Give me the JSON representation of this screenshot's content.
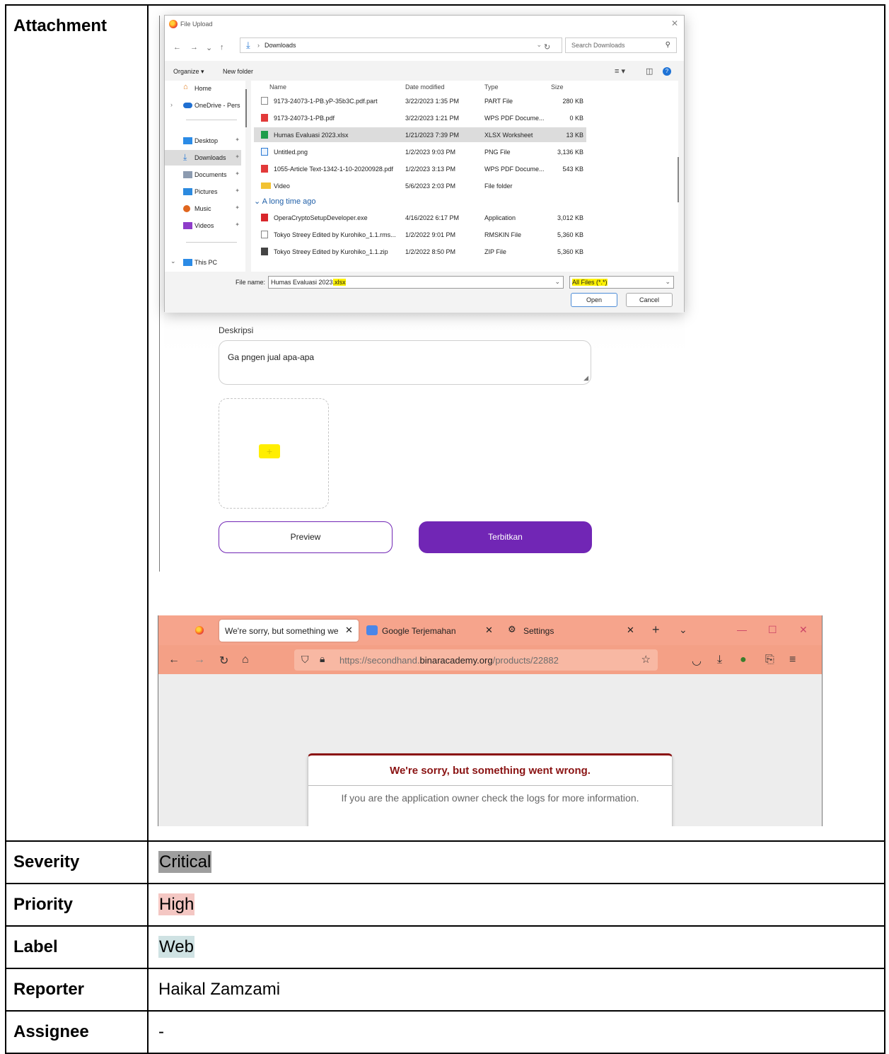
{
  "rows": {
    "attachment": {
      "label": "Attachment"
    },
    "severity": {
      "label": "Severity",
      "value": "Critical",
      "color": "#9e9e9e"
    },
    "priority": {
      "label": "Priority",
      "value": "High",
      "color": "#f4c7c3"
    },
    "label": {
      "label": "Label",
      "value": "Web",
      "color": "#cfe2e3"
    },
    "reporter": {
      "label": "Reporter",
      "value": "Haikal Zamzami"
    },
    "assignee": {
      "label": "Assignee",
      "value": "-"
    }
  },
  "dialog": {
    "title": "File Upload",
    "path": "Downloads",
    "search_placeholder": "Search Downloads",
    "organize": "Organize ▾",
    "new_folder": "New folder",
    "nav": [
      "Home",
      "OneDrive - Pers",
      "Desktop",
      "Downloads",
      "Documents",
      "Pictures",
      "Music",
      "Videos",
      "This PC"
    ],
    "columns": [
      "Name",
      "Date modified",
      "Type",
      "Size"
    ],
    "files": [
      {
        "name": "9173-24073-1-PB.yP-35b3C.pdf.part",
        "date": "3/22/2023 1:35 PM",
        "type": "PART File",
        "size": "280 KB"
      },
      {
        "name": "9173-24073-1-PB.pdf",
        "date": "3/22/2023 1:21 PM",
        "type": "WPS PDF Docume...",
        "size": "0 KB"
      },
      {
        "name": "Humas Evaluasi 2023.xlsx",
        "date": "1/21/2023 7:39 PM",
        "type": "XLSX Worksheet",
        "size": "13 KB"
      },
      {
        "name": "Untitled.png",
        "date": "1/2/2023 9:03 PM",
        "type": "PNG File",
        "size": "3,136 KB"
      },
      {
        "name": "1055-Article Text-1342-1-10-20200928.pdf",
        "date": "1/2/2023 3:13 PM",
        "type": "WPS PDF Docume...",
        "size": "543 KB"
      },
      {
        "name": "Video",
        "date": "5/6/2023 2:03 PM",
        "type": "File folder",
        "size": ""
      }
    ],
    "group_label": "A long time ago",
    "old_files": [
      {
        "name": "OperaCryptoSetupDeveloper.exe",
        "date": "4/16/2022 6:17 PM",
        "type": "Application",
        "size": "3,012 KB"
      },
      {
        "name": "Tokyo Streey Edited by Kurohiko_1.1.rms...",
        "date": "1/2/2022 9:01 PM",
        "type": "RMSKIN File",
        "size": "5,360 KB"
      },
      {
        "name": "Tokyo Streey Edited by Kurohiko_1.1.zip",
        "date": "1/2/2022 8:50 PM",
        "type": "ZIP File",
        "size": "5,360 KB"
      }
    ],
    "filename_label": "File name:",
    "filename_base": "Humas Evaluasi 2023",
    "filename_ext": ".xlsx",
    "filetype": "All Files (*.*)",
    "open": "Open",
    "cancel": "Cancel"
  },
  "form": {
    "description_label": "Deskripsi",
    "description_value": "Ga pngen jual apa-apa",
    "upload_plus": "+",
    "preview": "Preview",
    "publish": "Terbitkan"
  },
  "browser": {
    "tabs": [
      "We're sorry, but something went wrong",
      "Google Terjemahan",
      "Settings"
    ],
    "url_prefix": "https://secondhand.",
    "url_domain": "binaracademy.org",
    "url_path": "/products/22882",
    "error_title": "We're sorry, but something went wrong.",
    "error_message": "If you are the application owner check the logs for more information."
  }
}
